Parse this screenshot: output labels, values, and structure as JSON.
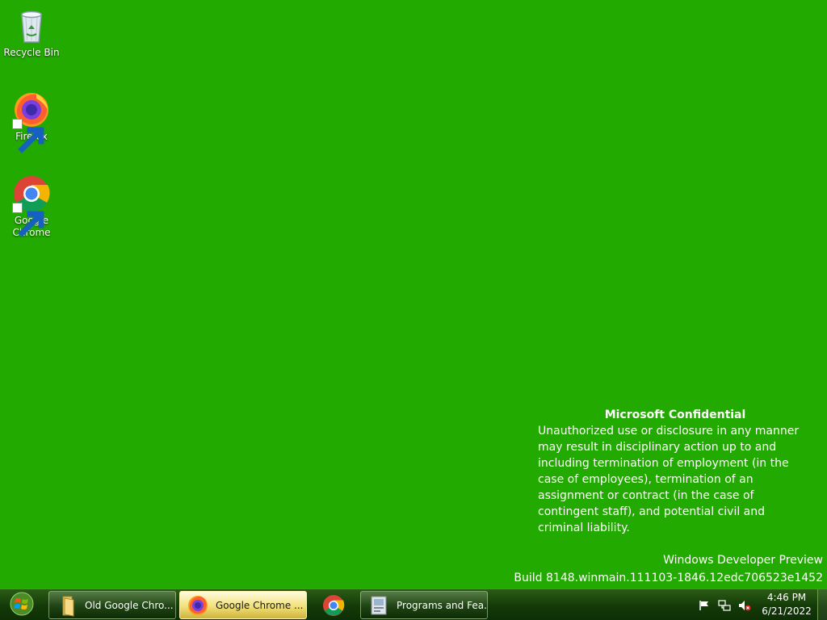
{
  "desktop": {
    "background_color": "#22aa00",
    "icons": [
      {
        "label": "Recycle Bin",
        "icon": "recycle-bin-icon"
      },
      {
        "label": "Firefox",
        "icon": "firefox-icon"
      },
      {
        "label": "Google Chrome",
        "icon": "chrome-icon"
      }
    ]
  },
  "confidential": {
    "heading": "Microsoft Confidential",
    "body": "Unauthorized use or disclosure in any manner may result in disciplinary action up to and including termination of employment (in the case of employees), termination of an assignment or contract (in the case of contingent staff), and potential civil and criminal liability."
  },
  "watermark": {
    "line1": "Windows Developer Preview",
    "line2": "Build 8148.winmain.111103-1846.12edc706523e1452"
  },
  "taskbar": {
    "start_icon": "windows-logo-icon",
    "buttons": [
      {
        "label": "Old Google Chro...",
        "icon": "folder-icon",
        "active": false
      },
      {
        "label": "Google Chrome ...",
        "icon": "firefox-icon",
        "active": true
      },
      {
        "label": "",
        "icon": "chrome-icon",
        "pinned": true
      },
      {
        "label": "Programs and Fea...",
        "icon": "programs-features-icon",
        "active": false
      }
    ],
    "tray": {
      "icons": [
        "action-center-flag-icon",
        "network-icon",
        "volume-muted-icon"
      ],
      "time": "4:46 PM",
      "date": "6/21/2022"
    }
  }
}
